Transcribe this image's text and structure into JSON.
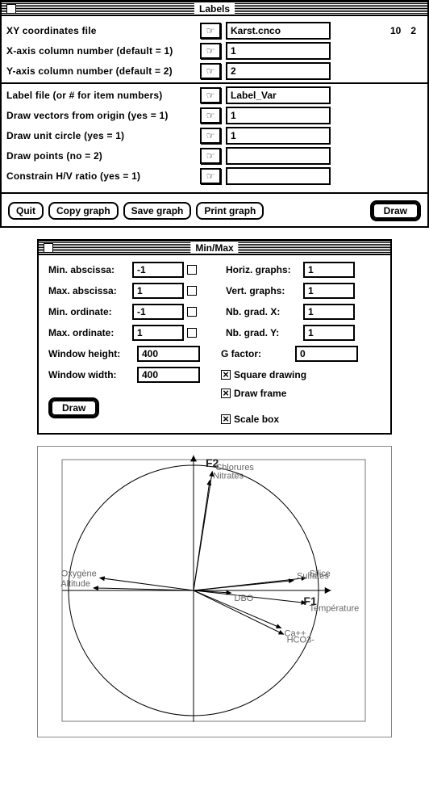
{
  "labels_window": {
    "title": "Labels",
    "rows": [
      {
        "label": "XY coordinates file",
        "value": "Karst.cnco",
        "tail": [
          "10",
          "2"
        ]
      },
      {
        "label": "X-axis column number (default = 1)",
        "value": "1"
      },
      {
        "label": "Y-axis column number (default = 2)",
        "value": "2"
      },
      {
        "divider": true
      },
      {
        "label": "Label file (or # for item numbers)",
        "value": "Label_Var"
      },
      {
        "label": "Draw vectors from origin (yes = 1)",
        "value": "1"
      },
      {
        "label": "Draw unit circle (yes = 1)",
        "value": "1"
      },
      {
        "label": "Draw points (no = 2)",
        "value": ""
      },
      {
        "label": "Constrain H/V ratio (yes = 1)",
        "value": ""
      }
    ],
    "buttons": {
      "quit": "Quit",
      "copy": "Copy graph",
      "save": "Save graph",
      "print": "Print graph",
      "draw": "Draw"
    }
  },
  "minmax_window": {
    "title": "Min/Max",
    "fields": {
      "min_abscissa_label": "Min. abscissa:",
      "min_abscissa": "-1",
      "max_abscissa_label": "Max. abscissa:",
      "max_abscissa": "1",
      "min_ordinate_label": "Min. ordinate:",
      "min_ordinate": "-1",
      "max_ordinate_label": "Max. ordinate:",
      "max_ordinate": "1",
      "horiz_label": "Horiz. graphs:",
      "horiz": "1",
      "vert_label": "Vert. graphs:",
      "vert": "1",
      "nbx_label": "Nb. grad. X:",
      "nbx": "1",
      "nby_label": "Nb. grad. Y:",
      "nby": "1",
      "wh_label": "Window height:",
      "wh": "400",
      "ww_label": "Window width:",
      "ww": "400",
      "g_label": "G factor:",
      "g": "0"
    },
    "checks": {
      "square": "Square drawing",
      "frame": "Draw frame",
      "scale": "Scale box"
    },
    "draw": "Draw"
  },
  "chart_data": {
    "type": "scatter",
    "title": "",
    "xlabel": "F1",
    "ylabel": "F2",
    "xlim": [
      -1,
      1
    ],
    "ylim": [
      -1,
      1
    ],
    "unit_circle": true,
    "series": [
      {
        "name": "Chlorures",
        "x": 0.15,
        "y": 0.95
      },
      {
        "name": "Nitrates",
        "x": 0.13,
        "y": 0.88
      },
      {
        "name": "Silice",
        "x": 0.9,
        "y": 0.1
      },
      {
        "name": "Sulfates",
        "x": 0.8,
        "y": 0.08
      },
      {
        "name": "Température",
        "x": 0.9,
        "y": -0.1
      },
      {
        "name": "Ca++",
        "x": 0.7,
        "y": -0.3
      },
      {
        "name": "HCO3-",
        "x": 0.72,
        "y": -0.35
      },
      {
        "name": "DBO",
        "x": 0.3,
        "y": -0.02
      },
      {
        "name": "Oxygène",
        "x": -0.75,
        "y": 0.1
      },
      {
        "name": "Altitude",
        "x": -0.8,
        "y": 0.02
      }
    ]
  },
  "icons": {
    "hand_glyph": "☞"
  }
}
